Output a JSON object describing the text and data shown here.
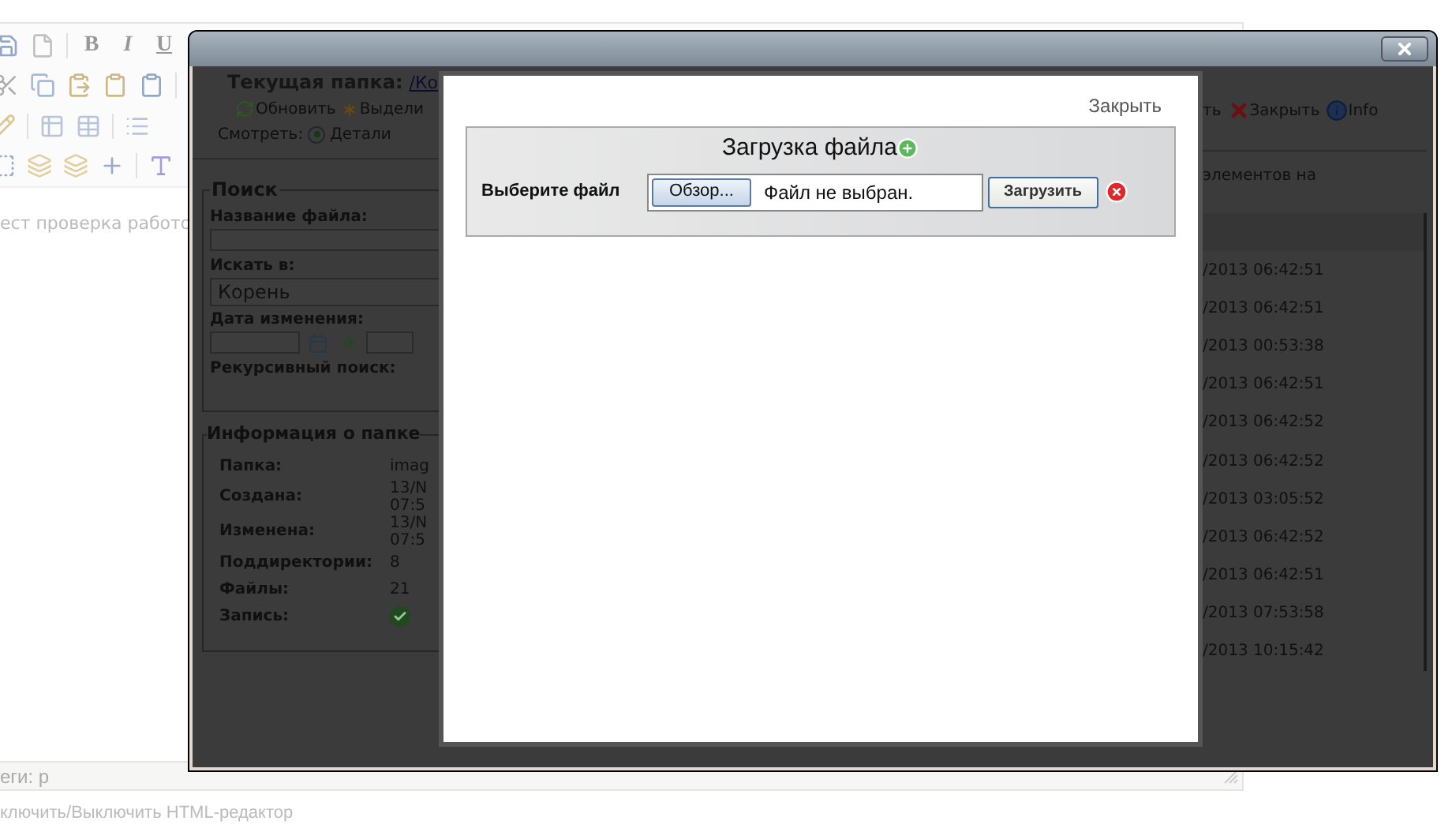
{
  "editor": {
    "toolbar_letters": [
      "B",
      "I",
      "U"
    ],
    "body_text": "ест проверка работо",
    "status_text": "еги: p",
    "footer_text": "ключить/Выключить HTML-редактор"
  },
  "file_manager": {
    "current_folder_label": "Текущая папка:",
    "current_folder_link": "/Ко",
    "toolbar_left": [
      {
        "label": "Обновить",
        "kind": "refresh"
      },
      {
        "label": "Выдели",
        "kind": "select"
      }
    ],
    "view_label": "Смотреть:",
    "view_options": [
      {
        "label": "Детали",
        "selected": true
      }
    ],
    "search": {
      "legend": "Поиск",
      "file_name_label": "Название файла:",
      "search_in_label": "Искать в:",
      "search_in_value": "Корень",
      "date_label": "Дата изменения:",
      "recursive_label": "Рекурсивный поиск:"
    },
    "folder_info": {
      "legend": "Информация о папке",
      "rows": [
        {
          "label": "Папка:",
          "kind": "text",
          "lines": [
            "imag"
          ]
        },
        {
          "label": "Создана:",
          "kind": "text",
          "lines": [
            "13/N",
            "07:5"
          ]
        },
        {
          "label": "Изменена:",
          "kind": "text",
          "lines": [
            "13/N",
            "07:5"
          ]
        },
        {
          "label": "Поддиректории:",
          "kind": "text",
          "lines": [
            "8"
          ]
        },
        {
          "label": "Файлы:",
          "kind": "text",
          "lines": [
            "21"
          ]
        },
        {
          "label": "Запись:",
          "kind": "check"
        }
      ]
    },
    "toolbar_right": [
      {
        "label": "ть",
        "kind": "plain"
      },
      {
        "label": "Закрыть",
        "kind": "close"
      },
      {
        "label": "Info",
        "kind": "info"
      }
    ],
    "page_size_text": "элементов на",
    "rows": [
      {
        "modified": "/2013 06:42:51"
      },
      {
        "modified": "/2013 06:42:51"
      },
      {
        "modified": "/2013 00:53:38"
      },
      {
        "modified": "/2013 06:42:51"
      },
      {
        "modified": "/2013 06:42:52"
      },
      {
        "modified": "/2013 06:42:52"
      },
      {
        "modified": "/2013 03:05:52"
      },
      {
        "modified": "/2013 06:42:52"
      },
      {
        "modified": "/2013 06:42:51"
      },
      {
        "modified": "/2013 07:53:58"
      },
      {
        "modified": "/2013 10:15:42"
      }
    ]
  },
  "upload": {
    "close_link": "Закрыть",
    "title": "Загрузка файла",
    "file_label": "Выберите файл",
    "browse_button": "Обзор...",
    "file_status": "Файл не выбран.",
    "upload_button": "Загрузить"
  }
}
